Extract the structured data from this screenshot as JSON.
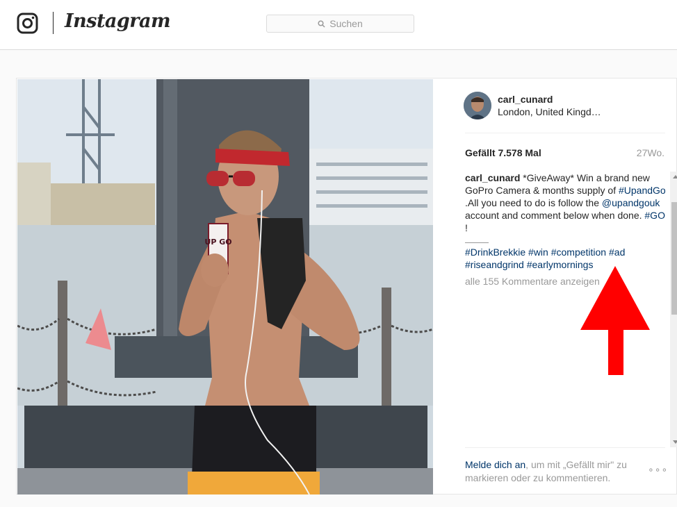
{
  "header": {
    "logo_wordmark": "Instagram",
    "search_placeholder": "Suchen",
    "icons": [
      "instagram-glyph-icon",
      "search-icon"
    ]
  },
  "post": {
    "username": "carl_cunard",
    "location": "London, United Kingd…",
    "likes": "Gefällt 7.578 Mal",
    "age": "27Wo.",
    "caption": {
      "author": "carl_cunard",
      "text_1": " *GiveAway* Win a brand new GoPro Camera & months supply of ",
      "tag_upandgo": "#UpandGo",
      "text_2": " .All you need to do is follow the ",
      "mention": "@upandgouk",
      "text_3": " account and comment below when done. ",
      "tag_go": "#GO",
      "text_4": " !"
    },
    "hashtags": [
      "#DrinkBrekkie",
      "#win",
      "#competition",
      "#ad",
      "#riseandgrind",
      "#earlymornings"
    ],
    "view_all_comments": "alle 155 Kommentare anzeigen",
    "login_prompt": {
      "link": "Melde dich an",
      "text": ", um mit „Gefällt mir\" zu markieren oder zu kommentieren."
    },
    "more_options": "∘∘∘",
    "photo_carton_text": "UP GO"
  },
  "annotation": {
    "color": "#ff0000",
    "shape": "arrow-up"
  }
}
